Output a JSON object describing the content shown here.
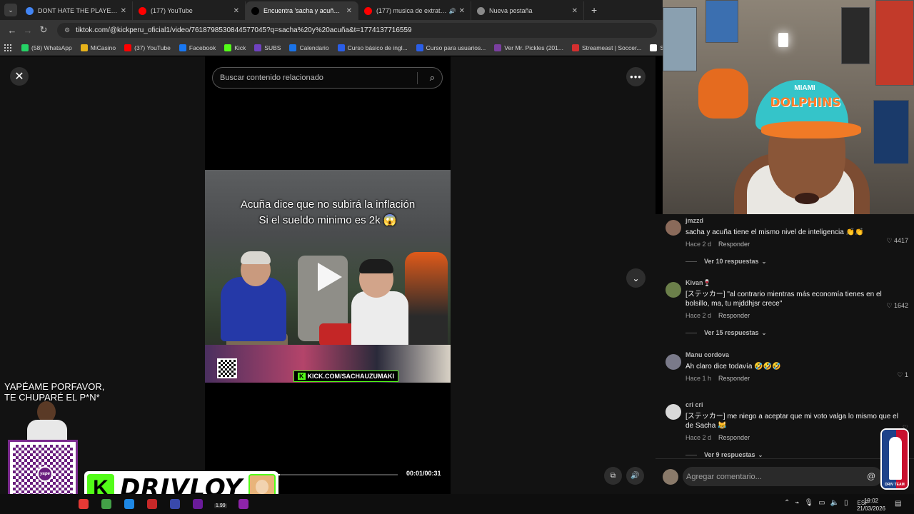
{
  "browser": {
    "tabs": [
      {
        "title": "DONT HATE THE PLAYER - Busc",
        "icon": "google-icon",
        "color": "#4285f4",
        "active": false,
        "audio": false
      },
      {
        "title": "(177) YouTube",
        "icon": "youtube-icon",
        "color": "#ff0000",
        "active": false,
        "audio": false
      },
      {
        "title": "Encuentra 'sacha y acuña' en Ti",
        "icon": "tiktok-icon",
        "color": "#000000",
        "active": true,
        "audio": false
      },
      {
        "title": "(177) musica de extraterres",
        "icon": "youtube-icon",
        "color": "#ff0000",
        "active": false,
        "audio": true
      },
      {
        "title": "Nueva pestaña",
        "icon": "chrome-icon",
        "color": "#8a8a8a",
        "active": false,
        "audio": false
      }
    ],
    "url": "tiktok.com/@kickperu_oficial1/video/7618798530844577045?q=sacha%20y%20acuña&t=1774137716559",
    "bookmarks": [
      {
        "label": "(58) WhatsApp",
        "color": "#25d366",
        "icon": "whatsapp-icon"
      },
      {
        "label": "MiCasino",
        "color": "#e7b21a",
        "icon": "casino-icon"
      },
      {
        "label": "(37) YouTube",
        "color": "#ff0000",
        "icon": "youtube-icon"
      },
      {
        "label": "Facebook",
        "color": "#1877f2",
        "icon": "facebook-icon"
      },
      {
        "label": "Kick",
        "color": "#53fc18",
        "icon": "kick-icon"
      },
      {
        "label": "SUBS",
        "color": "#6f42c1",
        "icon": "subs-icon"
      },
      {
        "label": "Calendario",
        "color": "#1a73e8",
        "icon": "calendar-icon"
      },
      {
        "label": "Curso básico de ingl...",
        "color": "#2a5ee8",
        "icon": "course-icon"
      },
      {
        "label": "Curso para usuarios...",
        "color": "#2a5ee8",
        "icon": "course-icon"
      },
      {
        "label": "Ver Mr. Pickles (201...",
        "color": "#7a3fa0",
        "icon": "tv-icon"
      },
      {
        "label": "Streameast | Soccer...",
        "color": "#d32f2f",
        "icon": "stream-icon"
      },
      {
        "label": "ShareDrop",
        "color": "#ffffff",
        "icon": "sharedrop-icon"
      }
    ]
  },
  "tiktok": {
    "search_placeholder": "Buscar contenido relacionado",
    "caption_line1": "Acuña dice que no subirá la inflación",
    "caption_line2": "Si el sueldo minimo es 2k 😱",
    "kick_tag": "KICK.COM/SACHAUZUMAKI",
    "timecode": "00:01/00:31",
    "progress_fraction": 0.03
  },
  "comments": [
    {
      "user": "jmzzd",
      "text": "sacha y acuña tiene el mismo nivel de inteligencia 👏👏",
      "time": "Hace 2 d",
      "reply": "Responder",
      "likes": "4417",
      "replies": "Ver 10 respuestas",
      "avatar_color": "#8a6a5a"
    },
    {
      "user": "Kivan🍷",
      "text": "[ステッカー] \"al contrario mientras más economía tienes en el bolsillo, ma, tu mjddhjsr crece\"",
      "time": "Hace 2 d",
      "reply": "Responder",
      "likes": "1642",
      "replies": "Ver 15 respuestas",
      "avatar_color": "#6b7f4a"
    },
    {
      "user": "Manu cordova",
      "text": "Ah claro dice todavía 🤣🤣🤣",
      "time": "Hace 1 h",
      "reply": "Responder",
      "likes": "1",
      "replies": "",
      "avatar_color": "#7a7a8a"
    },
    {
      "user": "cri cri",
      "text": "[ステッカー] me niego a aceptar que mi voto valga lo mismo que el de Sacha 😹",
      "time": "Hace 2 d",
      "reply": "Responder",
      "likes": "",
      "replies": "Ver 9 respuestas",
      "avatar_color": "#d8d8d8"
    }
  ],
  "comment_input": {
    "placeholder": "Agregar comentario..."
  },
  "overlay": {
    "yape_line1": "YAPÉAME PORFAVOR,",
    "yape_line2": "TE CHUPARÉ  EL P*N*",
    "streamer_name": "DRIVLOY",
    "yape_logo": "yape",
    "cap_team": "MIAMI",
    "cap_text": "DOLPHINS",
    "nba_text": "DRIV TEAM"
  },
  "taskbar": {
    "lang": "ESP",
    "time": "19:02",
    "date": "21/03/2026",
    "badge": "1.99"
  }
}
